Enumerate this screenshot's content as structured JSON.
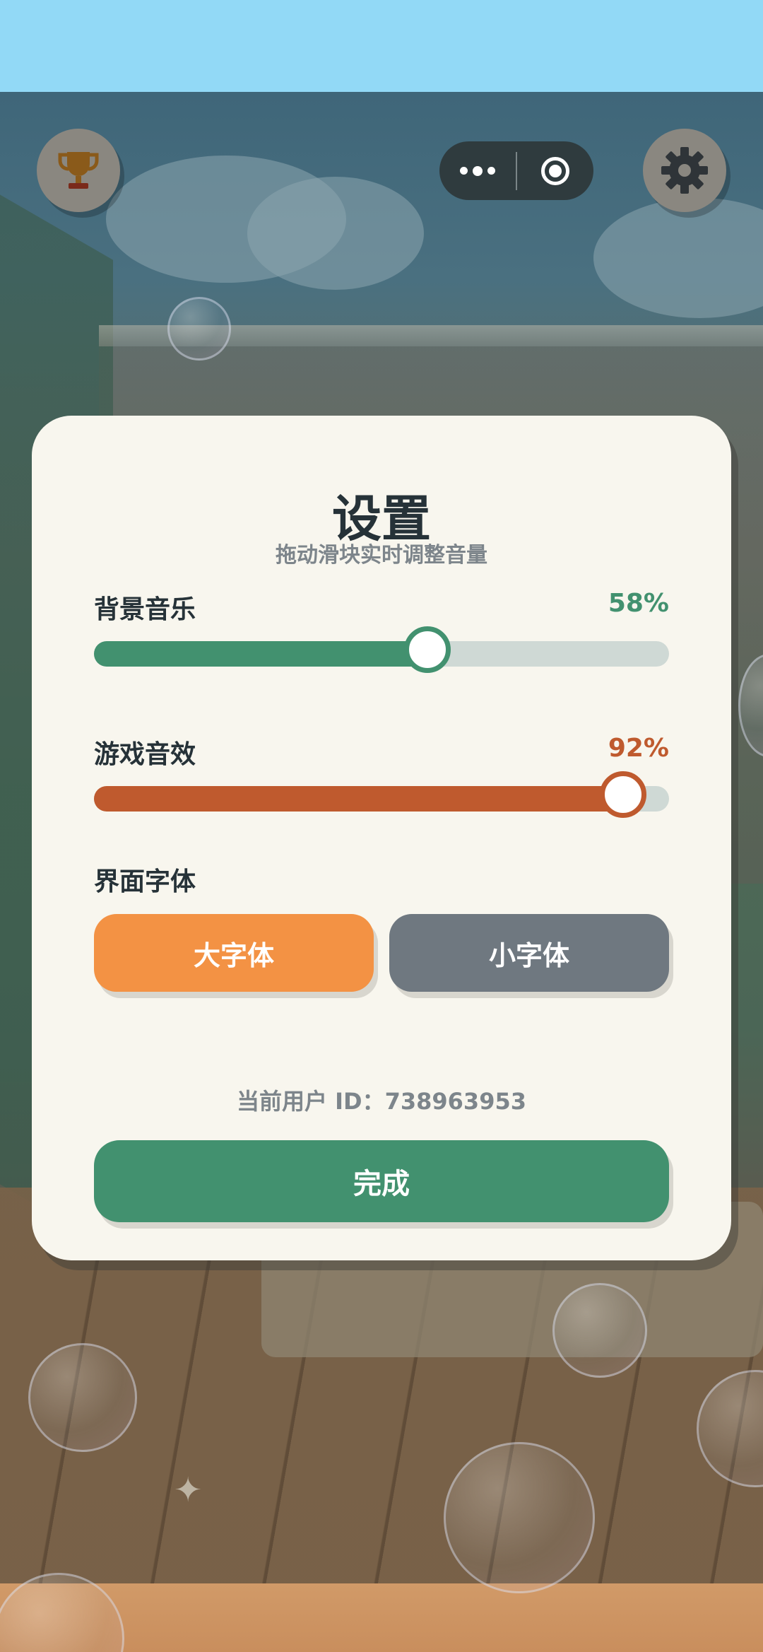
{
  "top_bar": {
    "trophy_icon": "trophy-icon",
    "more_icon": "more-dots-icon",
    "close_icon": "target-circle-icon",
    "settings_icon": "gear-icon"
  },
  "settings": {
    "title": "设置",
    "subtitle": "拖动滑块实时调整音量",
    "bgm": {
      "label": "背景音乐",
      "value_text": "58%",
      "value": 58,
      "color": "#42916f"
    },
    "sfx": {
      "label": "游戏音效",
      "value_text": "92%",
      "value": 92,
      "color": "#bf5a2e"
    },
    "font": {
      "label": "界面字体",
      "large_label": "大字体",
      "small_label": "小字体",
      "large_color": "#f39244",
      "small_color": "#6f7880"
    },
    "user_id": "当前用户 ID：738963953",
    "done_label": "完成"
  }
}
